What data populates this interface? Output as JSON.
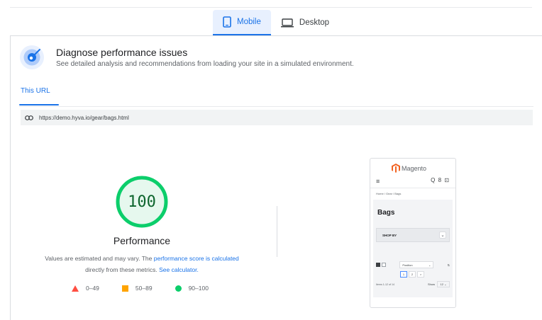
{
  "device_tabs": [
    {
      "label": "Mobile",
      "icon": "phone-icon",
      "active": true
    },
    {
      "label": "Desktop",
      "icon": "laptop-icon",
      "active": false
    }
  ],
  "diagnose": {
    "title": "Diagnose performance issues",
    "subtitle": "See detailed analysis and recommendations from loading your site in a simulated environment."
  },
  "url_tab": "This URL",
  "url": "https://demo.hyva.io/gear/bags.html",
  "score": {
    "value": "100",
    "fraction": 1.0,
    "label": "Performance",
    "color": "#0cce6b"
  },
  "note": {
    "text1": "Values are estimated and may vary. The ",
    "link1": "performance score is calculated",
    "text2": "directly from these metrics. ",
    "link2": "See calculator."
  },
  "legend": [
    {
      "range": "0–49",
      "shape": "triangle",
      "color": "#ff4e42"
    },
    {
      "range": "50–89",
      "shape": "square",
      "color": "#ffa400"
    },
    {
      "range": "90–100",
      "shape": "circle",
      "color": "#0cce6b"
    }
  ],
  "phone_preview": {
    "brand": "Magento",
    "brand_color": "#f26322",
    "menu_glyph": "≡",
    "header_icons": "Q 8 ⊡",
    "breadcrumb": "Home / Gear / Bags",
    "page_title": "Bags",
    "shop_by": "SHOP BY",
    "sort_label": "Position",
    "pages": [
      "1",
      "2",
      ">"
    ],
    "items_text": "Items 1-12 of 14",
    "show_label": "Show",
    "show_value": "12"
  }
}
